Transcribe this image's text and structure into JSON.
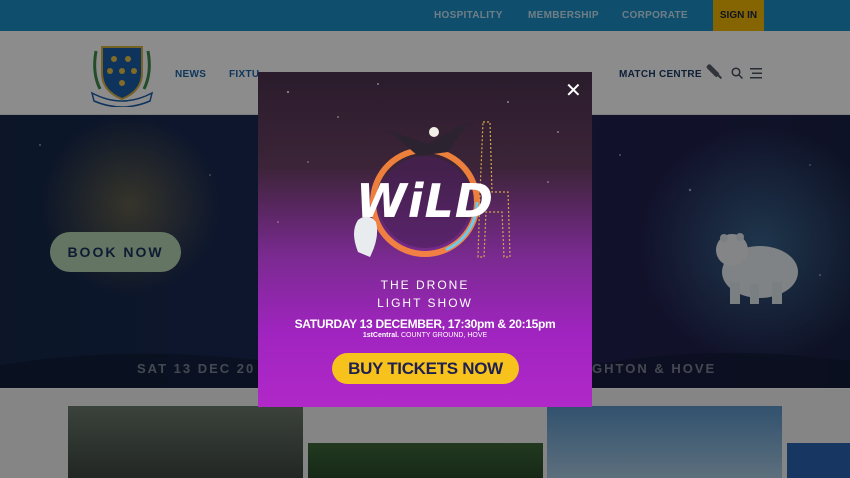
{
  "topbar": {
    "links": [
      "HOSPITALITY",
      "MEMBERSHIP",
      "CORPORATE"
    ],
    "sign_in": "SIGN IN"
  },
  "header": {
    "nav": [
      "NEWS",
      "FIXTU"
    ],
    "match_centre": "MATCH CENTRE"
  },
  "hero": {
    "cta": "BOOK NOW",
    "date": "SAT 13 DEC 20",
    "location": "GHTON & HOVE"
  },
  "popup": {
    "title": "WiLD",
    "subtitle_line1": "THE DRONE",
    "subtitle_line2": "LIGHT SHOW",
    "datetime": "SATURDAY 13 DECEMBER, 17:30pm & 20:15pm",
    "venue_brand": "1stCentral.",
    "venue": "COUNTY GROUND, HOVE",
    "cta": "BUY TICKETS NOW"
  },
  "colors": {
    "topbar": "#1d8fc7",
    "sign_in_bg": "#f2b705",
    "nav_text": "#1b64a8",
    "book_now_bg": "#b9d6b7",
    "buy_tickets_bg": "#f7c21b",
    "popup_purple": "#a024c0"
  },
  "icons": [
    "sussex-crest-logo",
    "cricket-bat-icon",
    "search-icon",
    "menu-icon",
    "close-icon"
  ]
}
